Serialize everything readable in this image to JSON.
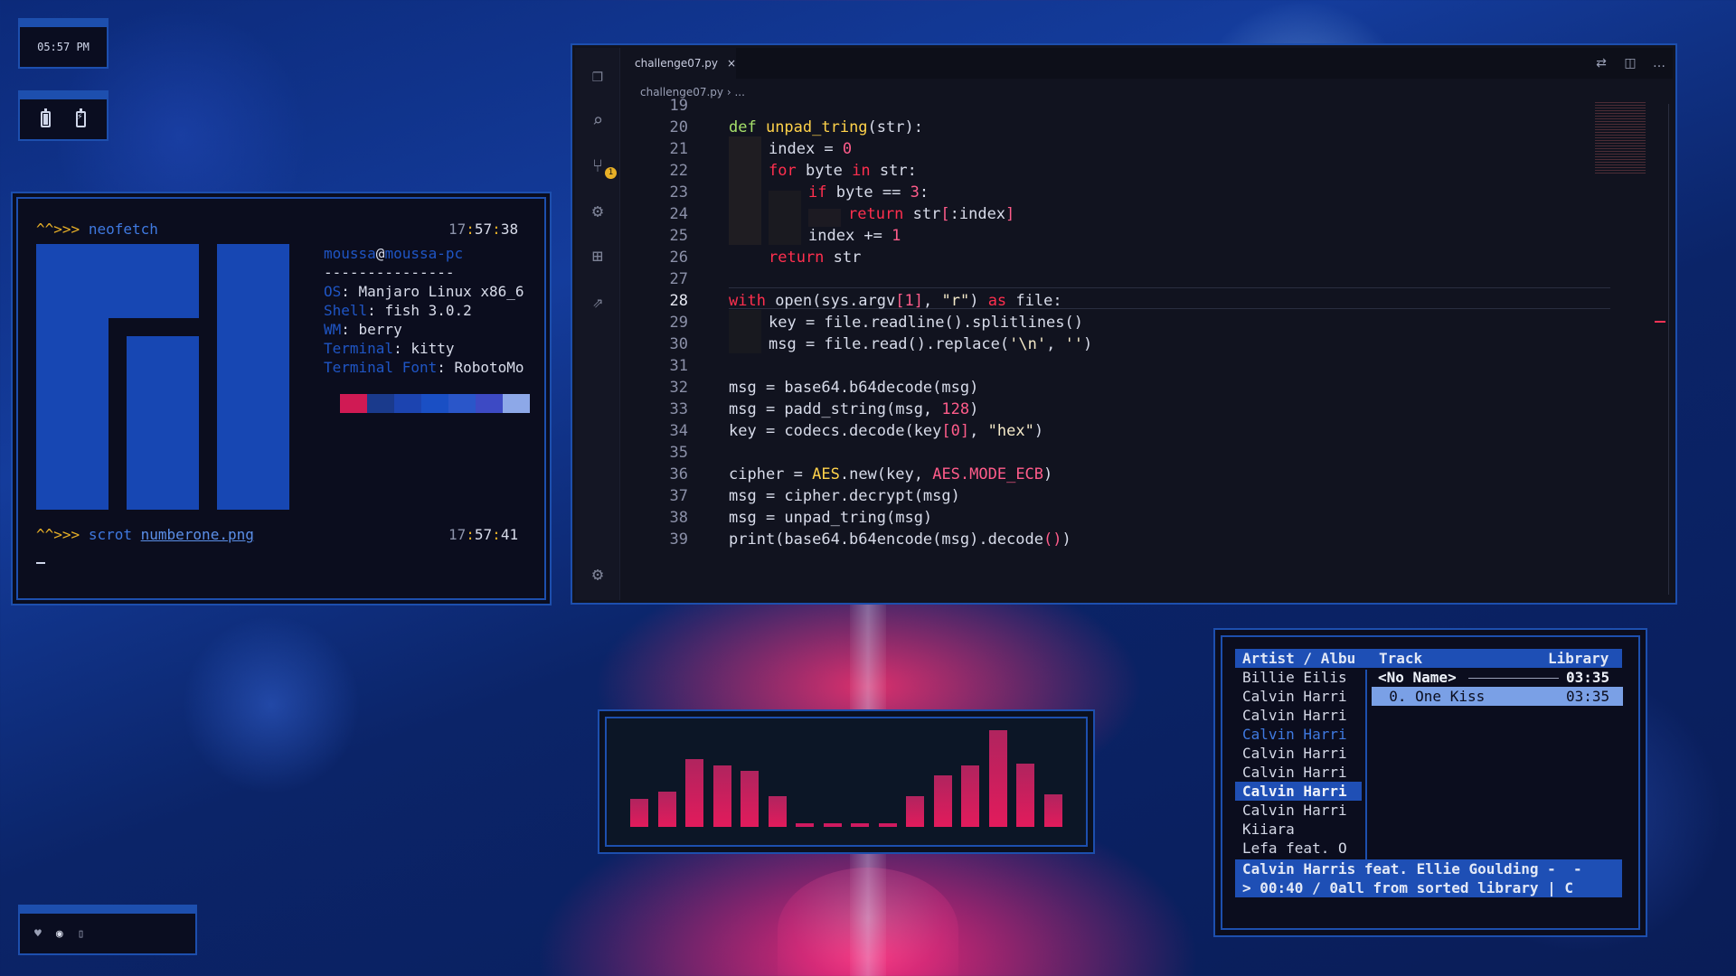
{
  "clock": {
    "time": "05:57 PM"
  },
  "terminal": {
    "prompt": "^^>>>",
    "cmd1": "neofetch",
    "time1": {
      "h": "17",
      "m": "57",
      "s": "38"
    },
    "user": "moussa",
    "at": "@",
    "host": "moussa-pc",
    "divider": "---------------",
    "info": [
      {
        "key": "OS",
        "value": ": Manjaro Linux x86_6"
      },
      {
        "key": "Shell",
        "value": ": fish 3.0.2"
      },
      {
        "key": "WM",
        "value": ": berry"
      },
      {
        "key": "Terminal",
        "value": ": kitty"
      },
      {
        "key": "Terminal Font",
        "value": ": RobotoMo"
      }
    ],
    "swatches": [
      "#d01a54",
      "#1a3a8c",
      "#1c44b0",
      "#1a4fc4",
      "#2a56c9",
      "#3d4ac4",
      "#8da8e8"
    ],
    "cmd2": "scrot",
    "arg2": "numberone.png",
    "time2": {
      "h": "17",
      "m": "57",
      "s": "41"
    }
  },
  "editor": {
    "tab": "challenge07.py",
    "close": "×",
    "breadcrumb": "challenge07.py › ...",
    "lines": [
      "19",
      "20",
      "21",
      "22",
      "23",
      "24",
      "25",
      "26",
      "27",
      "28",
      "29",
      "30",
      "31",
      "32",
      "33",
      "34",
      "35",
      "36",
      "37",
      "38",
      "39"
    ],
    "current_line": "28",
    "code": {
      "l20": {
        "a": "def",
        "b": " unpad_tring",
        "c": "(str):"
      },
      "l21": {
        "a": "index = ",
        "b": "0"
      },
      "l22": {
        "a": "for",
        "b": " byte ",
        "c": "in",
        "d": " str:"
      },
      "l23": {
        "a": "if",
        "b": " byte == ",
        "c": "3",
        "d": ":"
      },
      "l24": {
        "a": "return",
        "b": " str",
        "c": "[",
        "d": ":index",
        "e": "]"
      },
      "l25": {
        "a": "index += ",
        "b": "1"
      },
      "l26": {
        "a": "return",
        "b": " str"
      },
      "l28": {
        "a": "with",
        "b": " open(sys.argv",
        "c": "[",
        "d": "1",
        "e": "]",
        "f": ", ",
        "g": "\"r\"",
        "h": ")",
        "i": " as",
        "j": " file:"
      },
      "l29": {
        "a": "key = file.readline()",
        "b": ".splitlines()"
      },
      "l30": {
        "a": "msg = file.read()",
        "b": ".replace(",
        "c": "'\\n'",
        "d": ", ",
        "e": "''",
        "f": ")"
      },
      "l32": {
        "a": "msg = base64.b64decode(msg)"
      },
      "l33": {
        "a": "msg = padd_string(msg, ",
        "b": "128",
        "c": ")"
      },
      "l34": {
        "a": "key = codecs.decode(key",
        "b": "[",
        "c": "0",
        "d": "]",
        "e": ", ",
        "f": "\"hex\"",
        "g": ")"
      },
      "l36": {
        "a": "cipher = ",
        "b": "AES",
        "c": ".new(key, ",
        "d": "AES.MODE_ECB",
        "e": ")"
      },
      "l37": {
        "a": "msg = cipher.decrypt(msg)"
      },
      "l38": {
        "a": "msg = unpad_tring(msg)"
      },
      "l39": {
        "a": "print(base64.b64encode(msg).decode",
        "b": "()",
        "c": ")"
      }
    },
    "scm_badge": "1"
  },
  "visualizer": {
    "levels": [
      0.24,
      0.3,
      0.58,
      0.52,
      0.48,
      0.26,
      0.03,
      0.03,
      0.03,
      0.03,
      0.26,
      0.44,
      0.52,
      0.82,
      0.54,
      0.28
    ]
  },
  "player": {
    "col1": "Artist / Albu",
    "col2": "Track",
    "col3": "Library",
    "artists": [
      "Billie Eilis",
      "Calvin Harri",
      "Calvin Harri",
      "Calvin Harri",
      "Calvin Harri",
      "Calvin Harri",
      "Calvin Harri",
      "Calvin Harri",
      "Kiiara",
      "Lefa feat. O"
    ],
    "album": "<No Name>",
    "album_time": "03:35",
    "track": "  0. One Kiss",
    "track_time": "03:35",
    "now_playing": "Calvin Harris feat. Ellie Goulding -  -",
    "status": "> 00:40 / 0all from sorted library | C"
  },
  "colors": {
    "accent": "#1d4fae",
    "pink": "#e21b5c",
    "yellow": "#e8b027"
  },
  "icons": [
    "battery-icon",
    "battery-charging-icon",
    "files-icon",
    "search-icon",
    "source-control-icon",
    "debug-icon",
    "extensions-icon",
    "remote-icon",
    "settings-icon",
    "heart-icon",
    "discord-icon",
    "microphone-icon"
  ]
}
